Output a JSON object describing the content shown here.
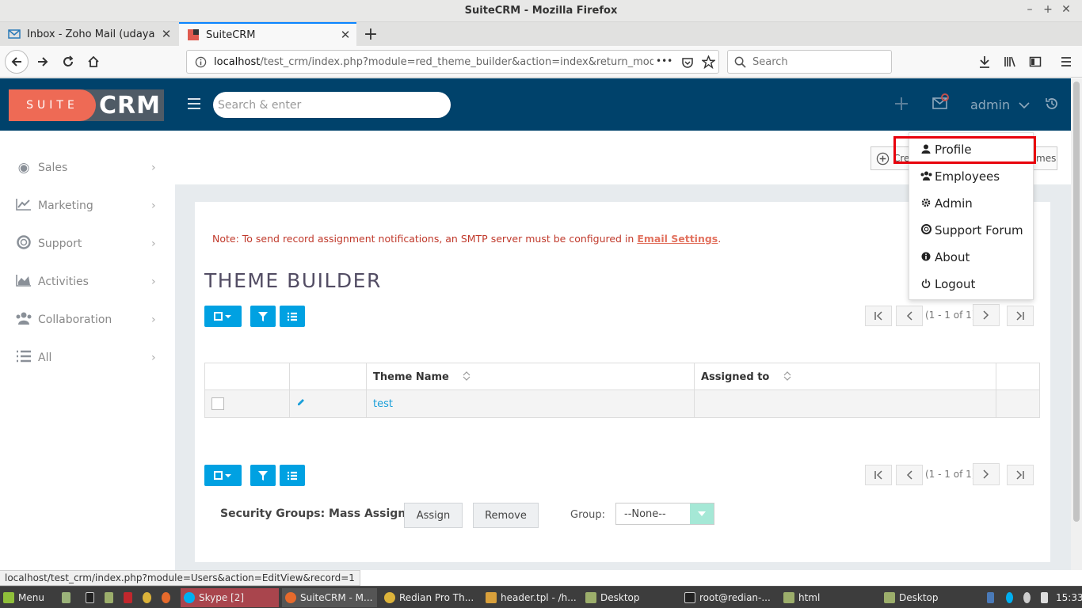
{
  "window": {
    "title": "SuiteCRM - Mozilla Firefox",
    "minimize": "–",
    "maximize": "+",
    "close": "✕"
  },
  "tabs": [
    {
      "label": "Inbox - Zoho Mail (udayagiri.r",
      "close": "✕"
    },
    {
      "label": "SuiteCRM",
      "close": "✕"
    }
  ],
  "newtab_label": "+",
  "nav": {
    "url_host": "localhost",
    "url_path": "/test_crm/index.php?module=red_theme_builder&action=index&return_module=red_t",
    "more": "•••",
    "search_placeholder": "Search"
  },
  "crm": {
    "logo_suite": "SUITE",
    "logo_crm": "CRM",
    "search_placeholder": "Search & enter",
    "user": "admin"
  },
  "sidebar": {
    "items": [
      {
        "label": "Sales",
        "icon": "target-icon"
      },
      {
        "label": "Marketing",
        "icon": "chart-line-icon"
      },
      {
        "label": "Support",
        "icon": "lifebuoy-icon"
      },
      {
        "label": "Activities",
        "icon": "area-chart-icon"
      },
      {
        "label": "Collaboration",
        "icon": "users-icon"
      },
      {
        "label": "All",
        "icon": "list-icon"
      }
    ]
  },
  "actions": {
    "create_prefix": "Cre",
    "view_suffix": "mes"
  },
  "notice": {
    "text": "Note: To send record assignment notifications, an SMTP server must be configured in ",
    "link": "Email Settings",
    "end": "."
  },
  "module_title": "THEME BUILDER",
  "pagination": {
    "count": "(1 - 1 of 1)"
  },
  "table": {
    "headers": [
      "",
      "",
      "Theme Name",
      "Assigned to",
      ""
    ],
    "rows": [
      {
        "name": "test",
        "assigned": ""
      }
    ]
  },
  "mass_assign": {
    "label": "Security Groups: Mass Assign",
    "assign": "Assign",
    "remove": "Remove",
    "group_label": "Group:",
    "group_value": "--None--"
  },
  "usermenu": {
    "items": [
      {
        "label": "Profile",
        "icon": "user-icon"
      },
      {
        "label": "Employees",
        "icon": "users-icon"
      },
      {
        "label": "Admin",
        "icon": "gear-icon"
      },
      {
        "label": "Support Forum",
        "icon": "lifebuoy-icon"
      },
      {
        "label": "About",
        "icon": "info-icon"
      },
      {
        "label": "Logout",
        "icon": "power-icon"
      }
    ]
  },
  "status_url": "localhost/test_crm/index.php?module=Users&action=EditView&record=1",
  "taskbar": {
    "menu": "Menu",
    "tasks": [
      "Skype [2]",
      "SuiteCRM - M...",
      "Redian Pro Th...",
      "header.tpl - /h...",
      "Desktop",
      "root@redian-...",
      "html",
      "Desktop"
    ],
    "clock": "15:33"
  },
  "colors": {
    "header": "#00426b",
    "accent": "#00a1e2",
    "logo_orange": "#ee6a55",
    "highlight": "#e8000b"
  }
}
